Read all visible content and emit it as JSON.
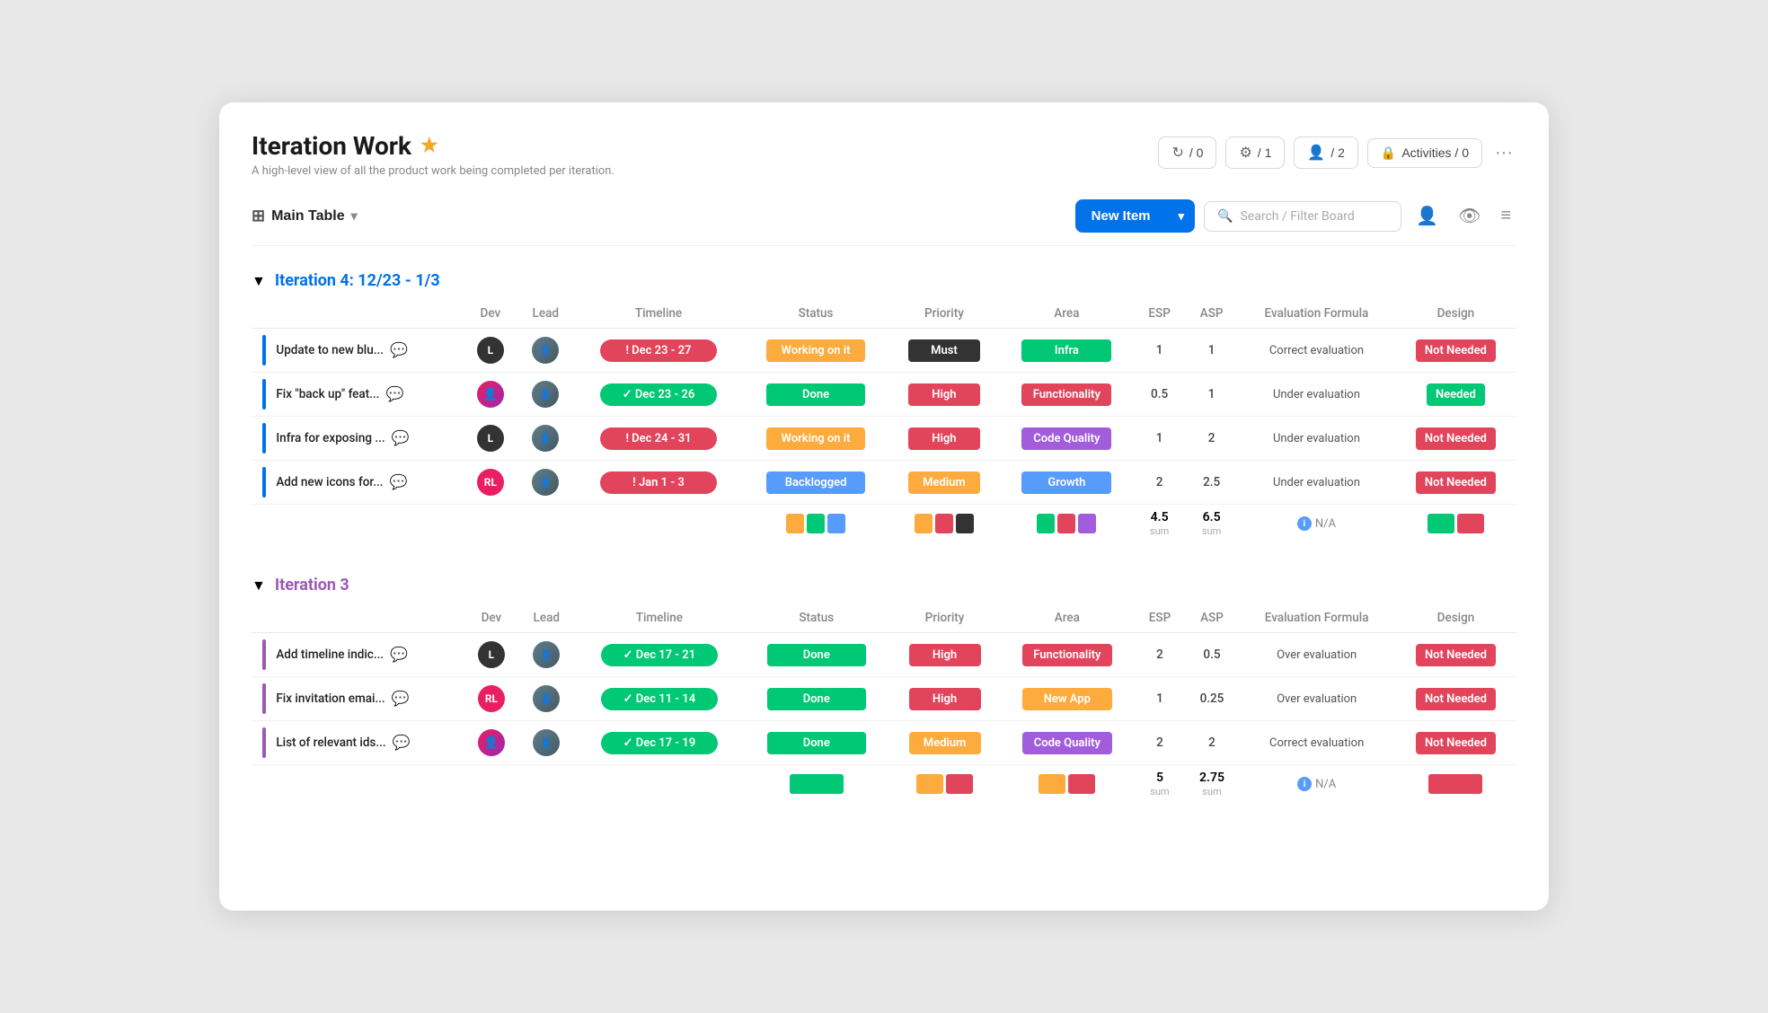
{
  "header": {
    "title": "Iteration Work",
    "subtitle": "A high-level view of all the product work being completed per iteration.",
    "star": "★",
    "stats": [
      {
        "id": "stat1",
        "icon": "🔄",
        "value": "/ 0"
      },
      {
        "id": "stat2",
        "icon": "🔧",
        "value": "/ 1"
      },
      {
        "id": "stat3",
        "icon": "👥",
        "value": "/ 2"
      }
    ],
    "activities": "Activities / 0",
    "more": "···"
  },
  "toolbar": {
    "table_label": "Main Table",
    "new_item_label": "New Item",
    "search_placeholder": "Search / Filter Board"
  },
  "iteration4": {
    "title": "Iteration 4: 12/23 - 1/3",
    "columns": [
      "Dev",
      "Lead",
      "Timeline",
      "Status",
      "Priority",
      "Area",
      "ESP",
      "ASP",
      "Evaluation Formula",
      "Design"
    ],
    "rows": [
      {
        "name": "Update to new blu...",
        "indicator_color": "#0073ea",
        "dev_initials": "L",
        "dev_color": "#333",
        "timeline": "! Dec 23 - 27",
        "timeline_class": "orange",
        "status": "Working on it",
        "status_class": "status-working",
        "priority": "Must",
        "priority_class": "priority-must",
        "area": "Infra",
        "area_class": "area-infra",
        "esp": "1",
        "asp": "1",
        "eval": "Correct evaluation",
        "design": "Not Needed",
        "design_class": "design-not-needed"
      },
      {
        "name": "Fix \"back up\" feat...",
        "indicator_color": "#0073ea",
        "dev_initials": "👥",
        "dev_color": "#e91e63",
        "timeline": "✓ Dec 23 - 26",
        "timeline_class": "green",
        "status": "Done",
        "status_class": "status-done",
        "priority": "High",
        "priority_class": "priority-high",
        "area": "Functionality",
        "area_class": "area-functionality",
        "esp": "0.5",
        "asp": "1",
        "eval": "Under evaluation",
        "design": "Needed",
        "design_class": "design-needed"
      },
      {
        "name": "Infra for exposing ...",
        "indicator_color": "#0073ea",
        "dev_initials": "L",
        "dev_color": "#333",
        "timeline": "! Dec 24 - 31",
        "timeline_class": "orange",
        "status": "Working on it",
        "status_class": "status-working",
        "priority": "High",
        "priority_class": "priority-high",
        "area": "Code Quality",
        "area_class": "area-code-quality",
        "esp": "1",
        "asp": "2",
        "eval": "Under evaluation",
        "design": "Not Needed",
        "design_class": "design-not-needed"
      },
      {
        "name": "Add new icons for...",
        "indicator_color": "#0073ea",
        "dev_initials": "RL",
        "dev_color": "#e91e63",
        "timeline": "! Jan 1 - 3",
        "timeline_class": "orange",
        "status": "Backlogged",
        "status_class": "status-backlogged",
        "priority": "Medium",
        "priority_class": "priority-medium",
        "area": "Growth",
        "area_class": "area-growth",
        "esp": "2",
        "asp": "2.5",
        "eval": "Under evaluation",
        "design": "Not Needed",
        "design_class": "design-not-needed"
      }
    ],
    "summary": {
      "esp_sum": "4.5",
      "asp_sum": "6.5",
      "eval_na": "N/A",
      "status_chips": [
        "#fdab3d",
        "#00c875",
        "#579bfc"
      ],
      "priority_chips": [
        "#fdab3d",
        "#e2445c",
        "#333"
      ],
      "area_chips": [
        "#00c875",
        "#e2445c",
        "#a25ddc"
      ],
      "design_chips": [
        "#00c875",
        "#e2445c"
      ]
    }
  },
  "iteration3": {
    "title": "Iteration 3",
    "columns": [
      "Dev",
      "Lead",
      "Timeline",
      "Status",
      "Priority",
      "Area",
      "ESP",
      "ASP",
      "Evaluation Formula",
      "Design"
    ],
    "rows": [
      {
        "name": "Add timeline indic...",
        "indicator_color": "#9b59b6",
        "dev_initials": "L",
        "dev_color": "#333",
        "timeline": "✓ Dec 17 - 21",
        "timeline_class": "green",
        "status": "Done",
        "status_class": "status-done",
        "priority": "High",
        "priority_class": "priority-high",
        "area": "Functionality",
        "area_class": "area-functionality",
        "esp": "2",
        "asp": "0.5",
        "eval": "Over evaluation",
        "design": "Not Needed",
        "design_class": "design-not-needed"
      },
      {
        "name": "Fix invitation emai...",
        "indicator_color": "#9b59b6",
        "dev_initials": "RL",
        "dev_color": "#e91e63",
        "timeline": "✓ Dec 11 - 14",
        "timeline_class": "green",
        "status": "Done",
        "status_class": "status-done",
        "priority": "High",
        "priority_class": "priority-high",
        "area": "New App",
        "area_class": "area-new-app",
        "esp": "1",
        "asp": "0.25",
        "eval": "Over evaluation",
        "design": "Not Needed",
        "design_class": "design-not-needed"
      },
      {
        "name": "List of relevant ids...",
        "indicator_color": "#9b59b6",
        "dev_initials": "👥",
        "dev_color": "#e91e63",
        "timeline": "✓ Dec 17 - 19",
        "timeline_class": "green",
        "status": "Done",
        "status_class": "status-done",
        "priority": "Medium",
        "priority_class": "priority-medium",
        "area": "Code Quality",
        "area_class": "area-code-quality",
        "esp": "2",
        "asp": "2",
        "eval": "Correct evaluation",
        "design": "Not Needed",
        "design_class": "design-not-needed"
      }
    ],
    "summary": {
      "esp_sum": "5",
      "asp_sum": "2.75",
      "eval_na": "N/A",
      "status_chips": [
        "#00c875"
      ],
      "priority_chips": [
        "#fdab3d",
        "#e2445c"
      ],
      "area_chips": [
        "#fdab3d",
        "#e2445c"
      ],
      "design_chips": [
        "#e2445c"
      ]
    }
  }
}
